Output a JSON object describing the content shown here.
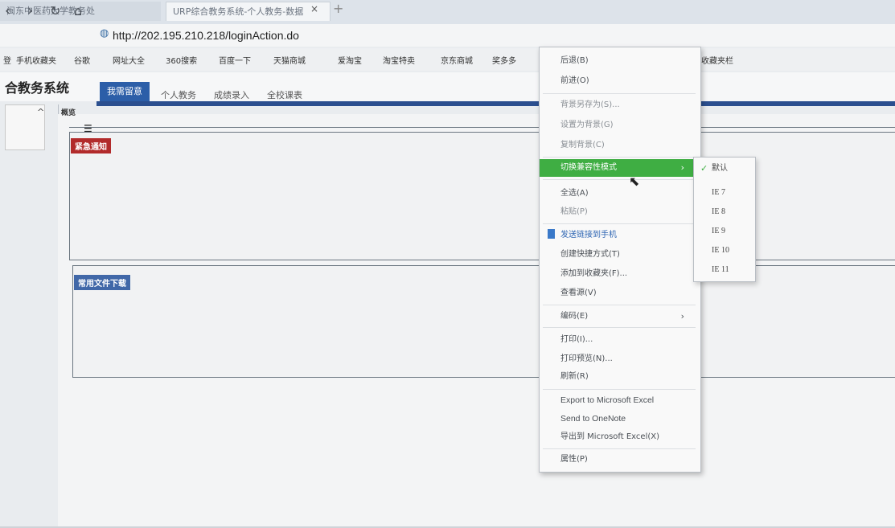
{
  "browser": {
    "tabs": [
      {
        "label": "闽东中医药大学教务处"
      },
      {
        "label": "URP综合教务系统-个人教务-数据"
      }
    ],
    "tab_close": "×",
    "tab_new": "+",
    "nav": {
      "back": "‹",
      "forward": "›",
      "refresh": "↻",
      "home": "⌂"
    },
    "url": "http://202.195.210.218/loginAction.do",
    "bookmarks": [
      "登",
      "手机收藏夹",
      "谷歌",
      "网址大全",
      "360搜索",
      "百度一下",
      "天猫商城",
      "爱淘宝",
      "淘宝特卖",
      "京东商城",
      "奖多多",
      "收藏夹栏"
    ]
  },
  "app": {
    "title": "合教务系统",
    "nav_tabs": [
      "我需留意",
      "个人教务",
      "成绩录入",
      "全校课表"
    ],
    "left_collapse": "^",
    "overview_label": "概览",
    "menu_glyph": "☰",
    "panels": {
      "urgent_notice": "紧急通知",
      "downloads": "常用文件下载"
    }
  },
  "context_menu": {
    "items": [
      {
        "label": "后退(B)"
      },
      {
        "label": "前进(O)"
      },
      {
        "label": "背景另存为(S)..."
      },
      {
        "label": "设置为背景(G)"
      },
      {
        "label": "复制背景(C)"
      },
      {
        "label": "切换兼容性模式"
      },
      {
        "label": "全选(A)"
      },
      {
        "label": "粘贴(P)"
      },
      {
        "label": "发送链接到手机"
      },
      {
        "label": "创建快捷方式(T)"
      },
      {
        "label": "添加到收藏夹(F)..."
      },
      {
        "label": "查看源(V)"
      },
      {
        "label": "编码(E)"
      },
      {
        "label": "打印(I)..."
      },
      {
        "label": "打印预览(N)..."
      },
      {
        "label": "刷新(R)"
      },
      {
        "label": "Export to Microsoft Excel"
      },
      {
        "label": "Send to OneNote"
      },
      {
        "label": "导出到 Microsoft Excel(X)"
      },
      {
        "label": "属性(P)"
      }
    ],
    "submenu_arrow": "›",
    "highlight_color": "#3fae43"
  },
  "compat_submenu": {
    "check": "✓",
    "items": [
      "默认",
      "IE 7",
      "IE 8",
      "IE 9",
      "IE 10",
      "IE 11"
    ]
  },
  "cursor": "⬉"
}
